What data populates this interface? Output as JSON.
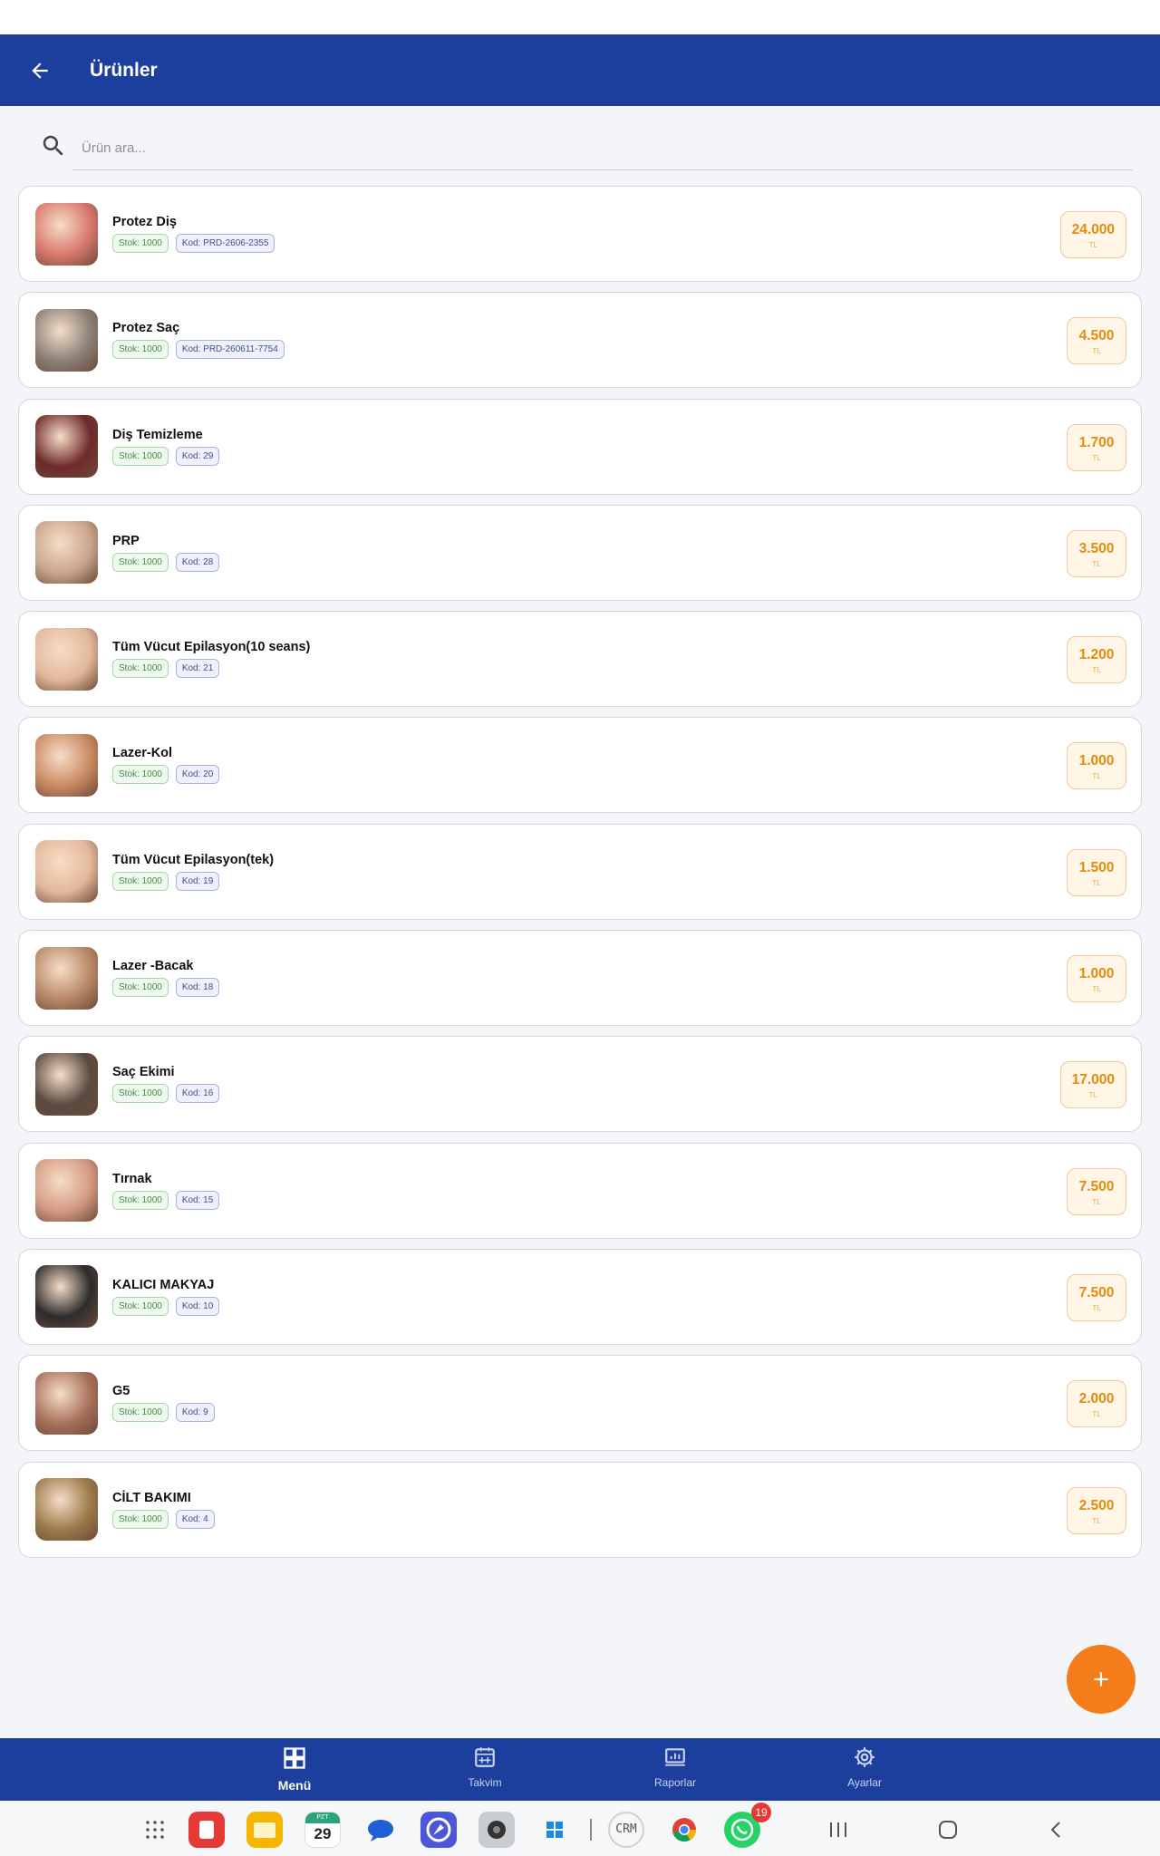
{
  "header": {
    "title": "Ürünler"
  },
  "search": {
    "placeholder": "Ürün ara..."
  },
  "products": [
    {
      "name": "Protez Diş",
      "stock": "Stok: 1000",
      "code": "Kod: PRD-2606-2355",
      "price": "24.000",
      "currency": "TL"
    },
    {
      "name": "Protez Saç",
      "stock": "Stok: 1000",
      "code": "Kod: PRD-260611-7754",
      "price": "4.500",
      "currency": "TL"
    },
    {
      "name": "Diş Temizleme",
      "stock": "Stok: 1000",
      "code": "Kod: 29",
      "price": "1.700",
      "currency": "TL"
    },
    {
      "name": "PRP",
      "stock": "Stok: 1000",
      "code": "Kod: 28",
      "price": "3.500",
      "currency": "TL"
    },
    {
      "name": "Tüm Vücut Epilasyon(10 seans)",
      "stock": "Stok: 1000",
      "code": "Kod: 21",
      "price": "1.200",
      "currency": "TL"
    },
    {
      "name": "Lazer-Kol",
      "stock": "Stok: 1000",
      "code": "Kod: 20",
      "price": "1.000",
      "currency": "TL"
    },
    {
      "name": "Tüm Vücut Epilasyon(tek)",
      "stock": "Stok: 1000",
      "code": "Kod: 19",
      "price": "1.500",
      "currency": "TL"
    },
    {
      "name": "Lazer -Bacak",
      "stock": "Stok: 1000",
      "code": "Kod: 18",
      "price": "1.000",
      "currency": "TL"
    },
    {
      "name": "Saç Ekimi",
      "stock": "Stok: 1000",
      "code": "Kod: 16",
      "price": "17.000",
      "currency": "TL"
    },
    {
      "name": "Tırnak",
      "stock": "Stok: 1000",
      "code": "Kod: 15",
      "price": "7.500",
      "currency": "TL"
    },
    {
      "name": "KALICI MAKYAJ",
      "stock": "Stok: 1000",
      "code": "Kod: 10",
      "price": "7.500",
      "currency": "TL"
    },
    {
      "name": "G5",
      "stock": "Stok: 1000",
      "code": "Kod: 9",
      "price": "2.000",
      "currency": "TL"
    },
    {
      "name": "CİLT BAKIMI",
      "stock": "Stok: 1000",
      "code": "Kod: 4",
      "price": "2.500",
      "currency": "TL"
    }
  ],
  "thumb_colors": [
    "#d9776b",
    "#8a8078",
    "#6e2a2a",
    "#c9a58c",
    "#e2b89a",
    "#c98a62",
    "#e2b89a",
    "#b88866",
    "#5a4a40",
    "#d49a82",
    "#2c2c2c",
    "#a8705a",
    "#9c7a4a"
  ],
  "bottom_nav": [
    {
      "label": "Menü",
      "icon": "grid-icon",
      "active": true
    },
    {
      "label": "Takvim",
      "icon": "calendar-icon",
      "active": false
    },
    {
      "label": "Raporlar",
      "icon": "report-icon",
      "active": false
    },
    {
      "label": "Ayarlar",
      "icon": "settings-icon",
      "active": false
    }
  ],
  "taskbar": {
    "calendar_day_label": "PZT",
    "calendar_day": "29",
    "crm_label": "CRM",
    "whatsapp_badge": "19"
  },
  "colors": {
    "primary": "#1c3f9e",
    "accent": "#f57c1a",
    "price": "#e58a0c"
  }
}
